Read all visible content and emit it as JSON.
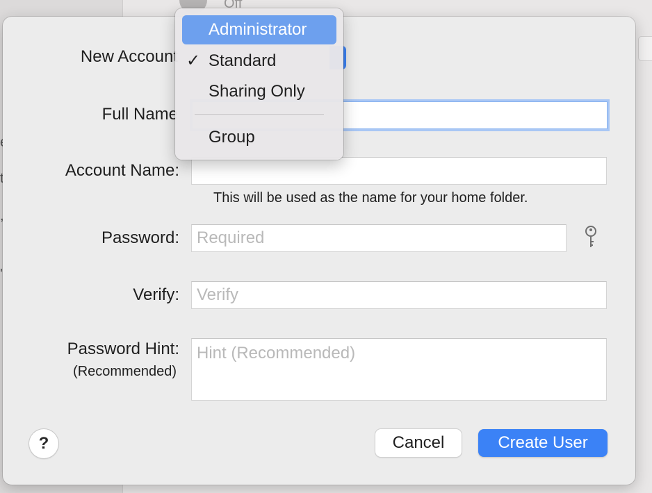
{
  "background": {
    "off_text": "Off"
  },
  "form": {
    "new_account_label": "New Account",
    "full_name_label": "Full Name",
    "account_name_label": "Account Name:",
    "account_name_help": "This will be used as the name for your home folder.",
    "password_label": "Password:",
    "password_placeholder": "Required",
    "verify_label": "Verify:",
    "verify_placeholder": "Verify",
    "hint_label": "Password Hint:",
    "hint_sublabel": "(Recommended)",
    "hint_placeholder": "Hint (Recommended)",
    "full_name_value": "",
    "account_name_value": ""
  },
  "account_type_menu": {
    "items": [
      {
        "label": "Administrator",
        "highlighted": true,
        "checked": false
      },
      {
        "label": "Standard",
        "highlighted": false,
        "checked": true
      },
      {
        "label": "Sharing Only",
        "highlighted": false,
        "checked": false
      },
      {
        "label": "Group",
        "highlighted": false,
        "checked": false
      }
    ],
    "checkmark": "✓"
  },
  "buttons": {
    "help": "?",
    "cancel": "Cancel",
    "create": "Create User"
  },
  "icons": {
    "password_assistant": "key-icon"
  },
  "colors": {
    "accent": "#3b82f6",
    "menu_highlight": "#6da0ee",
    "focus_ring": "#a9c7f5"
  }
}
